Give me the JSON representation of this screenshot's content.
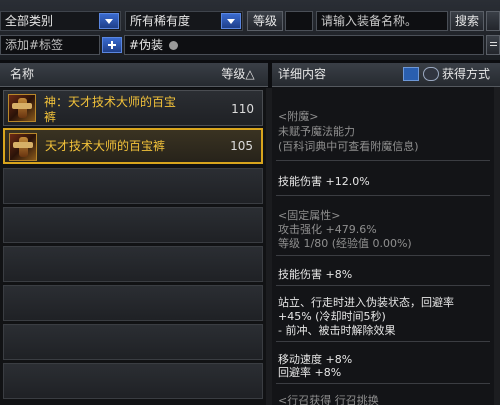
{
  "filters": {
    "category": "全部类别",
    "rarity": "所有稀有度",
    "level_label": "等级",
    "search_placeholder": "请输入装备名称。",
    "search_button": "搜索",
    "tag_placeholder": "添加#标签",
    "active_tag": "#伪装"
  },
  "list": {
    "col_name": "名称",
    "col_level": "等级△",
    "items": [
      {
        "name_line1": "神：天才技术大师的百宝",
        "name_line2": "裤",
        "level": "110"
      },
      {
        "name_line1": "天才技术大师的百宝裤",
        "level": "105"
      }
    ]
  },
  "detail": {
    "title": "详细内容",
    "get_method": "获得方式",
    "enchant_header": "<附魔>",
    "enchant_line1": "未赋予魔法能力",
    "enchant_line2": "(百科词典中可查看附魔信息)",
    "skill_damage_1_label": "技能伤害",
    "skill_damage_1_value": "+12.0%",
    "fixed_header": "<固定属性>",
    "attack_strength": "攻击强化 +479.6%",
    "level_exp": "等级 1/80 (经验值 0.00%)",
    "skill_damage_2_label": "技能伤害",
    "skill_damage_2_value": "+8%",
    "desc_line1": "站立、行走时进入伪装状态，回避率",
    "desc_line2": "+45% (冷却时间5秒)",
    "desc_line3": "- 前冲、被击时解除效果",
    "move_speed": "移动速度 +8%",
    "evasion": "回避率 +8%",
    "cut_line": "<行召获得 行召挑换"
  },
  "colors": {
    "item_name": "#f2c23a",
    "selected_border": "#d9a51d",
    "accent_blue": "#3a6bd0"
  }
}
